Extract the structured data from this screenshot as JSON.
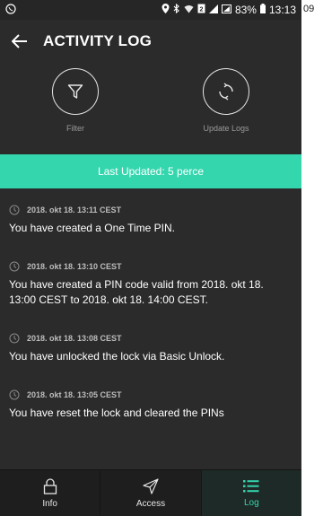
{
  "statusbar": {
    "left_icon": "whatsapp-icon",
    "battery": "83%",
    "time": "13:13"
  },
  "edge_number": "09",
  "header": {
    "title": "ACTIVITY LOG"
  },
  "actions": {
    "filter_label": "Filter",
    "update_label": "Update Logs"
  },
  "banner": {
    "text": "Last Updated: 5 perce"
  },
  "logs": [
    {
      "time": "2018. okt 18. 13:11 CEST",
      "text": "You have created a One Time PIN."
    },
    {
      "time": "2018. okt 18. 13:10 CEST",
      "text": "You have created a PIN code valid from 2018. okt 18. 13:00 CEST to 2018. okt 18. 14:00 CEST."
    },
    {
      "time": "2018. okt 18. 13:08 CEST",
      "text": "You have unlocked the lock via Basic Unlock."
    },
    {
      "time": "2018. okt 18. 13:05 CEST",
      "text": "You have reset the lock and cleared the PINs"
    }
  ],
  "nav": {
    "items": [
      {
        "label": "Info",
        "icon": "lock-icon"
      },
      {
        "label": "Access",
        "icon": "send-icon"
      },
      {
        "label": "Log",
        "icon": "list-icon"
      }
    ],
    "active": "Log"
  },
  "colors": {
    "accent": "#34d6ae",
    "background": "#2b2b2b"
  }
}
